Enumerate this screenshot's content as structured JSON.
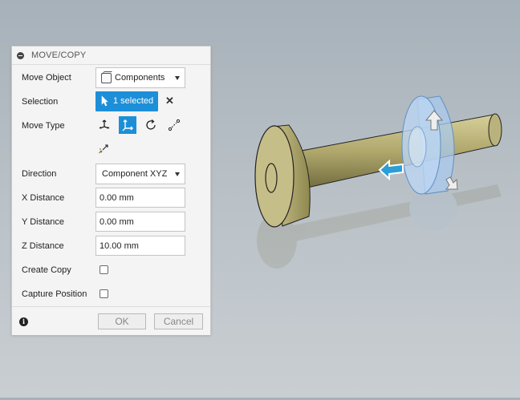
{
  "panel": {
    "title": "MOVE/COPY",
    "move_object": {
      "label": "Move Object",
      "value": "Components"
    },
    "selection": {
      "label": "Selection",
      "button_text": "1 selected"
    },
    "move_type": {
      "label": "Move Type"
    },
    "direction": {
      "label": "Direction",
      "value": "Component XYZ"
    },
    "x_distance": {
      "label": "X Distance",
      "value": "0.00 mm"
    },
    "y_distance": {
      "label": "Y Distance",
      "value": "0.00 mm"
    },
    "z_distance": {
      "label": "Z Distance",
      "value": "10.00 mm"
    },
    "create_copy": {
      "label": "Create Copy"
    },
    "capture_position": {
      "label": "Capture Position"
    },
    "ok_label": "OK",
    "cancel_label": "Cancel"
  },
  "colors": {
    "accent": "#1d8fd8",
    "model_brass": "#b5ad73",
    "gizmo_arrow": "#2a9ed6",
    "selected_part": "#a9c9ee"
  },
  "icons": [
    "collapse-icon",
    "cube-icon",
    "cursor-icon",
    "close-icon",
    "free-move-icon",
    "translate-icon",
    "rotate-icon",
    "point-to-point-icon",
    "point-to-position-icon",
    "chevron-down-icon",
    "info-icon"
  ]
}
